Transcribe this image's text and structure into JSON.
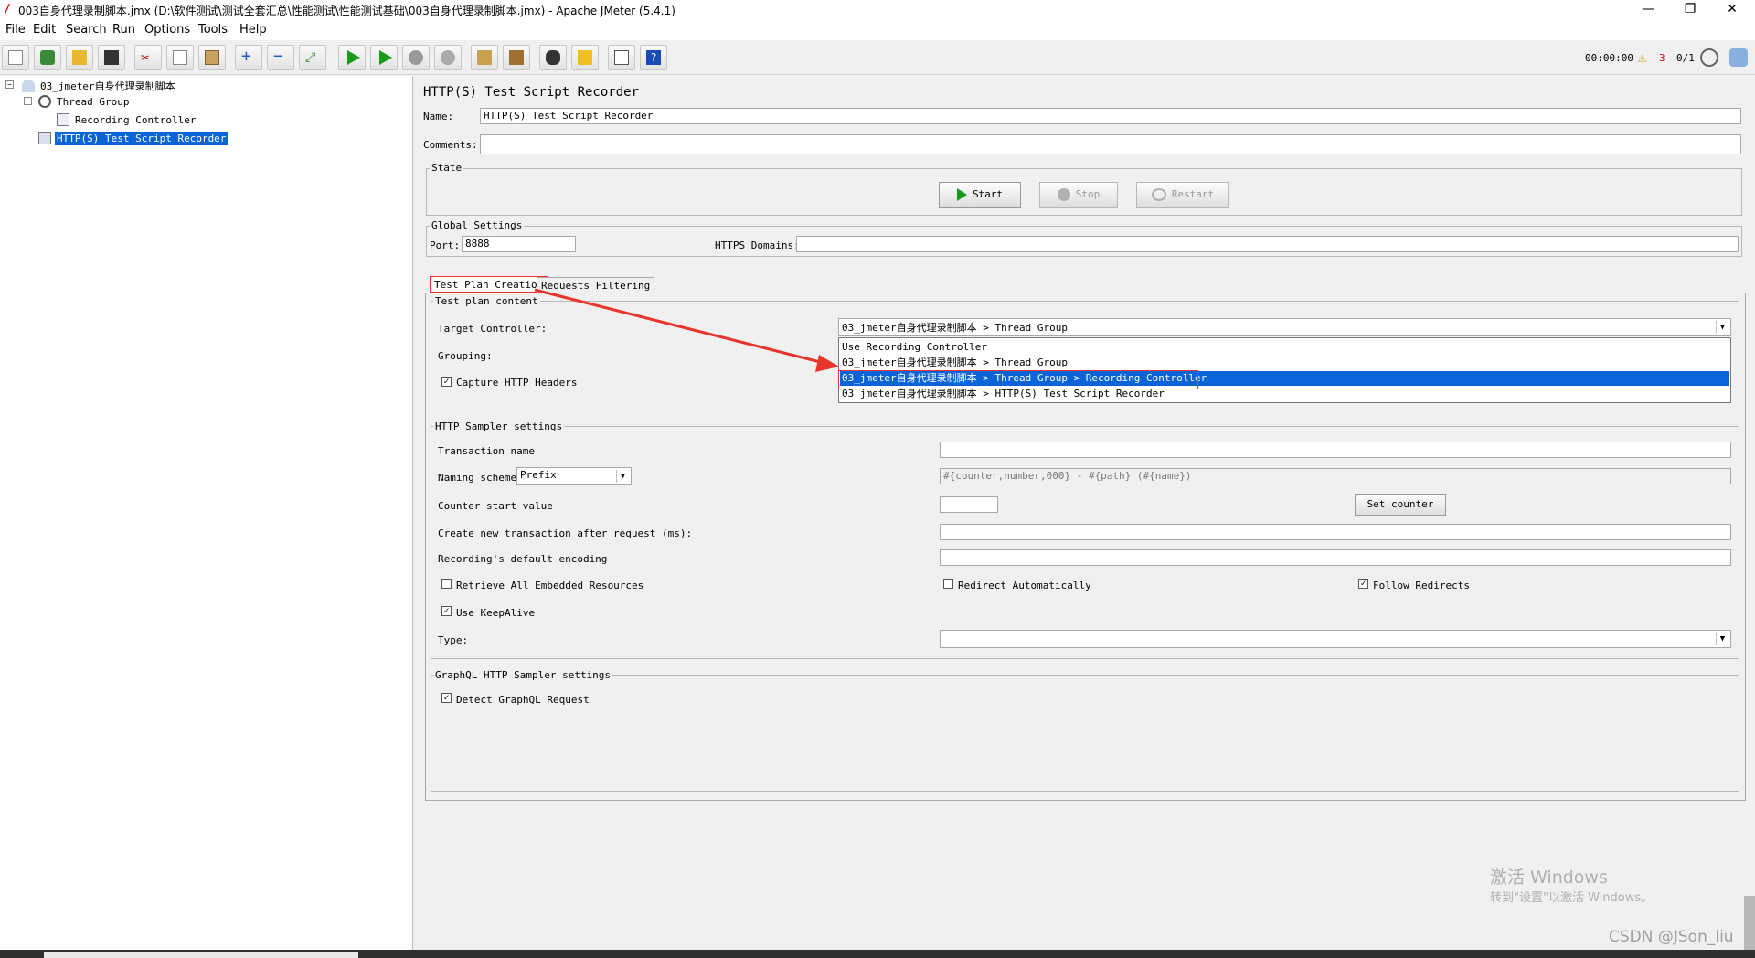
{
  "window": {
    "title": "003自身代理录制脚本.jmx (D:\\软件测试\\测试全套汇总\\性能测试\\性能测试基础\\003自身代理录制脚本.jmx) - Apache JMeter (5.4.1)",
    "minimize": "—",
    "maximize": "❐",
    "close": "✕"
  },
  "menu": [
    "File",
    "Edit",
    "Search",
    "Run",
    "Options",
    "Tools",
    "Help"
  ],
  "toolbar": {
    "buttons": [
      "new-icon",
      "templates-icon",
      "open-icon",
      "save-icon",
      "cut-icon",
      "copy-icon",
      "paste-icon",
      "expand-icon",
      "collapse-icon",
      "toggle-icon",
      "start-icon",
      "start-no-pauses-icon",
      "stop-icon",
      "shutdown-icon",
      "clear-icon",
      "clear-all-icon",
      "search-icon",
      "reset-search-icon",
      "function-helper-icon",
      "help-icon"
    ],
    "timer": "00:00:00",
    "warning_count": "3",
    "threads": "0/1"
  },
  "tree": {
    "root": "03_jmeter自身代理录制脚本",
    "thread_group": "Thread Group",
    "recording_controller": "Recording Controller",
    "recorder": "HTTP(S) Test Script Recorder"
  },
  "panel": {
    "title": "HTTP(S) Test Script Recorder",
    "name_label": "Name:",
    "name_value": "HTTP(S) Test Script Recorder",
    "comments_label": "Comments:",
    "comments_value": "",
    "state_legend": "State",
    "start_label": "Start",
    "stop_label": "Stop",
    "restart_label": "Restart",
    "global_legend": "Global Settings",
    "port_label": "Port:",
    "port_value": "8888",
    "https_label": "HTTPS Domains:",
    "https_value": ""
  },
  "tabs": [
    "Test Plan Creation",
    "Requests Filtering"
  ],
  "test_plan": {
    "legend": "Test plan content",
    "target_label": "Target Controller:",
    "target_value": "03_jmeter自身代理录制脚本 > Thread Group",
    "grouping_label": "Grouping:",
    "capture_label": "Capture HTTP Headers",
    "dropdown": [
      "Use Recording Controller",
      "03_jmeter自身代理录制脚本 > Thread Group",
      "03_jmeter自身代理录制脚本 > Thread Group > Recording Controller",
      "03_jmeter自身代理录制脚本 > HTTP(S) Test Script Recorder"
    ]
  },
  "sampler": {
    "legend": "HTTP Sampler settings",
    "transaction_label": "Transaction name",
    "transaction_value": "",
    "naming_label": "Naming scheme",
    "naming_value": "Prefix",
    "naming_format": "#{counter,number,000} - #{path} (#{name})",
    "counter_label": "Counter start value",
    "counter_value": "",
    "set_counter_label": "Set counter",
    "create_label": "Create new transaction after request (ms):",
    "encoding_label": "Recording's default encoding",
    "retrieve_label": "Retrieve All Embedded Resources",
    "redirect_label": "Redirect Automatically",
    "follow_label": "Follow Redirects",
    "keepalive_label": "Use KeepAlive",
    "type_label": "Type:"
  },
  "graphql": {
    "legend": "GraphQL HTTP Sampler settings",
    "detect_label": "Detect GraphQL Request"
  },
  "watermark": {
    "line1": "激活 Windows",
    "line2": "转到\"设置\"以激活 Windows。",
    "csdn": "CSDN @JSon_liu"
  },
  "colors": {
    "selection": "#0a64d8",
    "annotation": "#e8342a"
  }
}
